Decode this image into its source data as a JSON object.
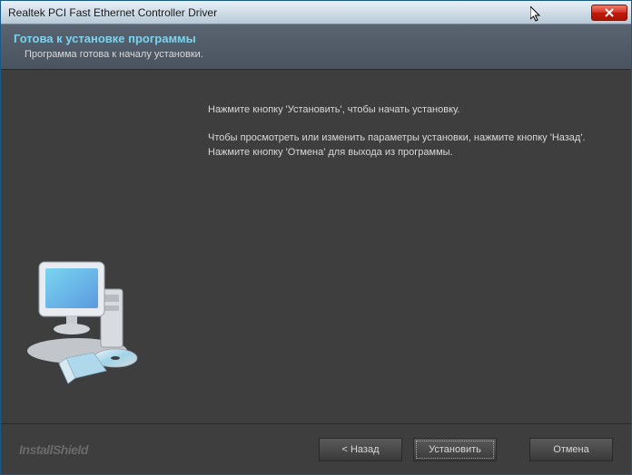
{
  "titlebar": {
    "title": "Realtek PCI Fast Ethernet Controller Driver"
  },
  "header": {
    "title": "Готова к установке программы",
    "subtitle": "Программа готова к началу установки."
  },
  "content": {
    "line1": "Нажмите кнопку 'Установить', чтобы начать установку.",
    "line2": "Чтобы просмотреть или изменить параметры установки, нажмите кнопку 'Назад'. Нажмите кнопку 'Отмена' для выхода из программы."
  },
  "footer": {
    "brand": "InstallShield",
    "back": "< Назад",
    "install": "Установить",
    "cancel": "Отмена"
  }
}
